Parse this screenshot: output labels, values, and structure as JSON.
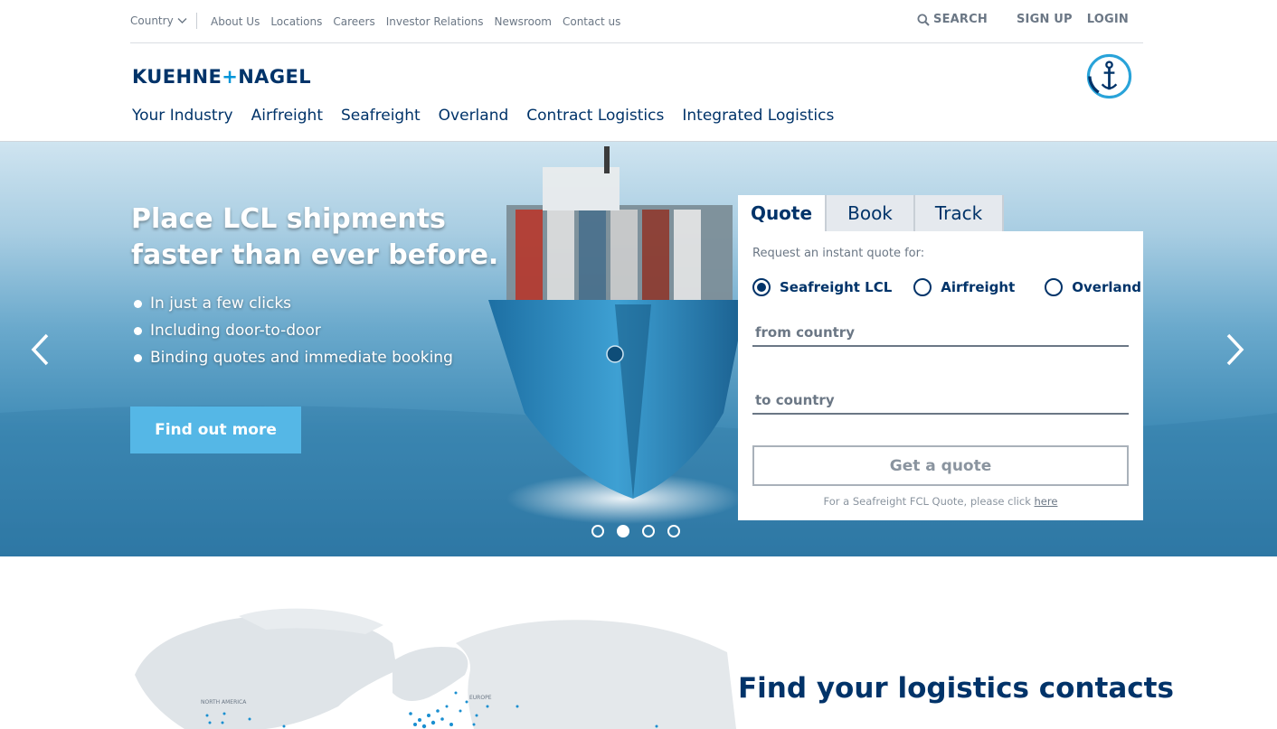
{
  "utility": {
    "country_label": "Country",
    "links": [
      "About Us",
      "Locations",
      "Careers",
      "Investor Relations",
      "Newsroom",
      "Contact us"
    ],
    "search_label": "SEARCH",
    "signup_label": "SIGN UP",
    "login_label": "LOGIN"
  },
  "brand": {
    "logo_left": "KUEHNE",
    "logo_plus": "+",
    "logo_right": "NAGEL"
  },
  "nav": {
    "items": [
      "Your Industry",
      "Airfreight",
      "Seafreight",
      "Overland",
      "Contract Logistics",
      "Integrated Logistics"
    ]
  },
  "hero": {
    "title_line1": "Place LCL shipments",
    "title_line2": "faster than ever before.",
    "bullets": [
      "In just a few clicks",
      "Including door-to-door",
      "Binding quotes and immediate booking"
    ],
    "cta_label": "Find out more",
    "slide_count": 4,
    "active_slide": 2
  },
  "quote": {
    "tabs": [
      "Quote",
      "Book",
      "Track"
    ],
    "active_tab": "Quote",
    "intro": "Request an instant quote for:",
    "modes": [
      "Seafreight LCL",
      "Airfreight",
      "Overland"
    ],
    "selected_mode": "Seafreight LCL",
    "from_placeholder": "from country",
    "to_placeholder": "to country",
    "button_label": "Get a quote",
    "footnote_text": "For a Seafreight FCL Quote, please click ",
    "footnote_link": "here"
  },
  "map": {
    "labels": [
      "NORTH AMERICA",
      "EUROPE"
    ]
  },
  "contacts": {
    "title": "Find your logistics contacts"
  },
  "colors": {
    "brand_navy": "#003369",
    "brand_blue": "#0095d9",
    "cta_blue": "#55b7e6",
    "muted_text": "#6b7785"
  }
}
